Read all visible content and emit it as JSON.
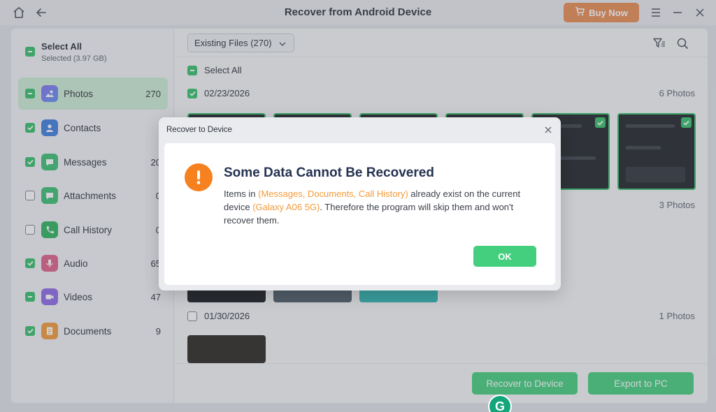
{
  "window": {
    "title": "Recover from Android Device",
    "buy_label": "Buy Now"
  },
  "sidebar": {
    "select_all_label": "Select All",
    "selected_info": "Selected (3.97 GB)",
    "categories": [
      {
        "label": "Photos",
        "count": "270",
        "state": "partial",
        "icon": "photos-icon",
        "color": "#7a6af0"
      },
      {
        "label": "Contacts",
        "count": "",
        "state": "checked",
        "icon": "contacts-icon",
        "color": "#3f7fe0"
      },
      {
        "label": "Messages",
        "count": "20",
        "state": "checked",
        "icon": "messages-icon",
        "color": "#3bbf72"
      },
      {
        "label": "Attachments",
        "count": "0",
        "state": "empty",
        "icon": "attachments-icon",
        "color": "#3bbf72"
      },
      {
        "label": "Call History",
        "count": "0",
        "state": "empty",
        "icon": "call-history-icon",
        "color": "#2fb35e"
      },
      {
        "label": "Audio",
        "count": "65",
        "state": "checked",
        "icon": "audio-icon",
        "color": "#e0608a"
      },
      {
        "label": "Videos",
        "count": "47",
        "state": "partial",
        "icon": "videos-icon",
        "color": "#8f6ae8"
      },
      {
        "label": "Documents",
        "count": "9",
        "state": "checked",
        "icon": "documents-icon",
        "color": "#f39a3a"
      }
    ]
  },
  "main": {
    "filter_dropdown": "Existing Files (270)",
    "select_all_label": "Select All",
    "groups": [
      {
        "date": "02/23/2026",
        "count": "6 Photos"
      },
      {
        "date": "",
        "count": "3 Photos"
      },
      {
        "date": "01/30/2026",
        "count": "1 Photos"
      }
    ],
    "recover_button": "Recover to Device",
    "export_button": "Export to PC"
  },
  "dialog": {
    "title": "Recover to Device",
    "heading": "Some Data Cannot Be Recovered",
    "text_1": "Items in ",
    "highlight_items": "(Messages, Documents, Call History)",
    "text_2": " already exist on the current device ",
    "highlight_device": "(Galaxy A06 5G)",
    "text_3": ". Therefore the program will skip them and won't recover them.",
    "ok_label": "OK"
  },
  "colors": {
    "accent_green": "#43cf7d",
    "check_green": "#35c06a",
    "buy_orange": "#e98c52",
    "warning_orange": "#f7801f",
    "highlight_orange": "#f39a3a"
  }
}
